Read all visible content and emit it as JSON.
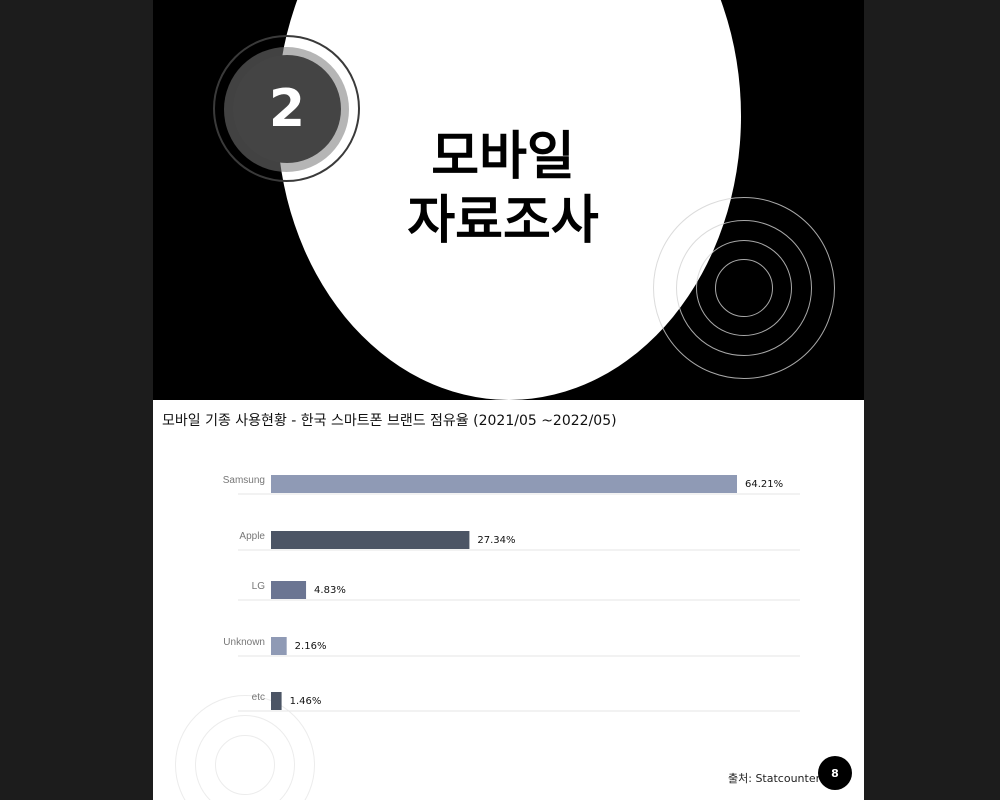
{
  "slide": {
    "section_number": "2",
    "title_line1": "모바일",
    "title_line2": "자료조사",
    "page_number": "8"
  },
  "chart_title": "모바일 기종 사용현황 - 한국 스마트폰 브랜드 점유율 (2021/05 ~2022/05)",
  "source": "출처: Statcounter",
  "chart_data": {
    "type": "bar",
    "orientation": "horizontal",
    "categories": [
      "Samsung",
      "Apple",
      "LG",
      "Unknown",
      "etc"
    ],
    "values": [
      64.21,
      27.34,
      4.83,
      2.16,
      1.46
    ],
    "value_labels": [
      "64.21%",
      "27.34%",
      "4.83%",
      "2.16%",
      "1.46%"
    ],
    "colors": [
      "#8f9ab5",
      "#4c5565",
      "#6b7592",
      "#8f9ab5",
      "#4c5565"
    ],
    "title": "모바일 기종 사용현황 - 한국 스마트폰 브랜드 점유율 (2021/05 ~2022/05)",
    "xlim": [
      0,
      64.21
    ],
    "grid": true
  }
}
